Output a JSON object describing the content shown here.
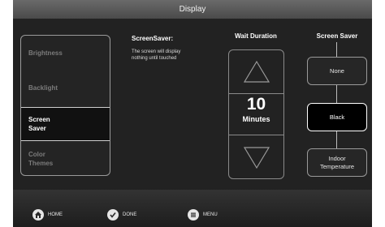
{
  "header": {
    "title": "Display"
  },
  "sidebar": {
    "items": [
      {
        "label": "Brightness",
        "active": false
      },
      {
        "label": "Backlight",
        "active": false
      },
      {
        "label": "Screen Saver",
        "active": true
      },
      {
        "label": "Color Themes",
        "active": false
      }
    ]
  },
  "info": {
    "title": "ScreenSaver:",
    "text": "The screen will display nothing until touched"
  },
  "wait": {
    "label": "Wait Duration",
    "value": "10",
    "unit": "Minutes"
  },
  "screensaver": {
    "label": "Screen Saver",
    "options": [
      {
        "label": "None",
        "selected": false
      },
      {
        "label": "Black",
        "selected": true
      },
      {
        "label": "Indoor Temperature",
        "selected": false
      }
    ]
  },
  "footer": {
    "home_label": "HOME",
    "done_label": "DONE",
    "menu_label": "MENU"
  },
  "colors": {
    "background": "#2d2d2d",
    "text": "#ffffff",
    "inactive_text": "#7b7b7b"
  }
}
